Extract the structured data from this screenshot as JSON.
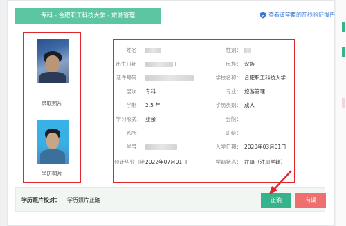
{
  "header": {
    "title": "专科 - 合肥职工科技大学 - 旅游管理",
    "verify_link": "查看该学籍的在线验证报告"
  },
  "photos": {
    "enrollment_caption": "录取照片",
    "degree_caption": "学历照片"
  },
  "fields": {
    "name_label": "姓名：",
    "gender_label": "性别：",
    "birth_label": "出生日期：",
    "birth_value_tail": "日",
    "ethnicity_label": "民族：",
    "ethnicity_value": "汉族",
    "id_label": "证件号码：",
    "school_label": "学校名称：",
    "school_value": "合肥职工科技大学",
    "level_label": "层次：",
    "level_value": "专科",
    "major_label": "专业：",
    "major_value": "旅游管理",
    "duration_label": "学制：",
    "duration_value": "2.5 年",
    "edu_type_label": "学历类别：",
    "edu_type_value": "成人",
    "study_mode_label": "学习形式：",
    "study_mode_value": "业余",
    "branch_label": "分院：",
    "department_label": "系所：",
    "class_label": "班级：",
    "student_no_label": "学号：",
    "enroll_date_label": "入学日期：",
    "enroll_date_value": "2020年03月01日",
    "grad_date_label": "预计毕业日期：",
    "grad_date_value": "2022年07月01日",
    "status_label": "学籍状态：",
    "status_value": "在籍（注册学籍）"
  },
  "footer": {
    "label": "学历照片校对：",
    "value": "学历照片正确",
    "ok_button": "正确",
    "wrong_button": "有误"
  },
  "colors": {
    "header_green": "#5cc6a3",
    "ok_green": "#36b38a",
    "wrong_red": "#ef6e6e",
    "highlight_red": "#e0272c",
    "link_blue": "#3b77d8"
  }
}
